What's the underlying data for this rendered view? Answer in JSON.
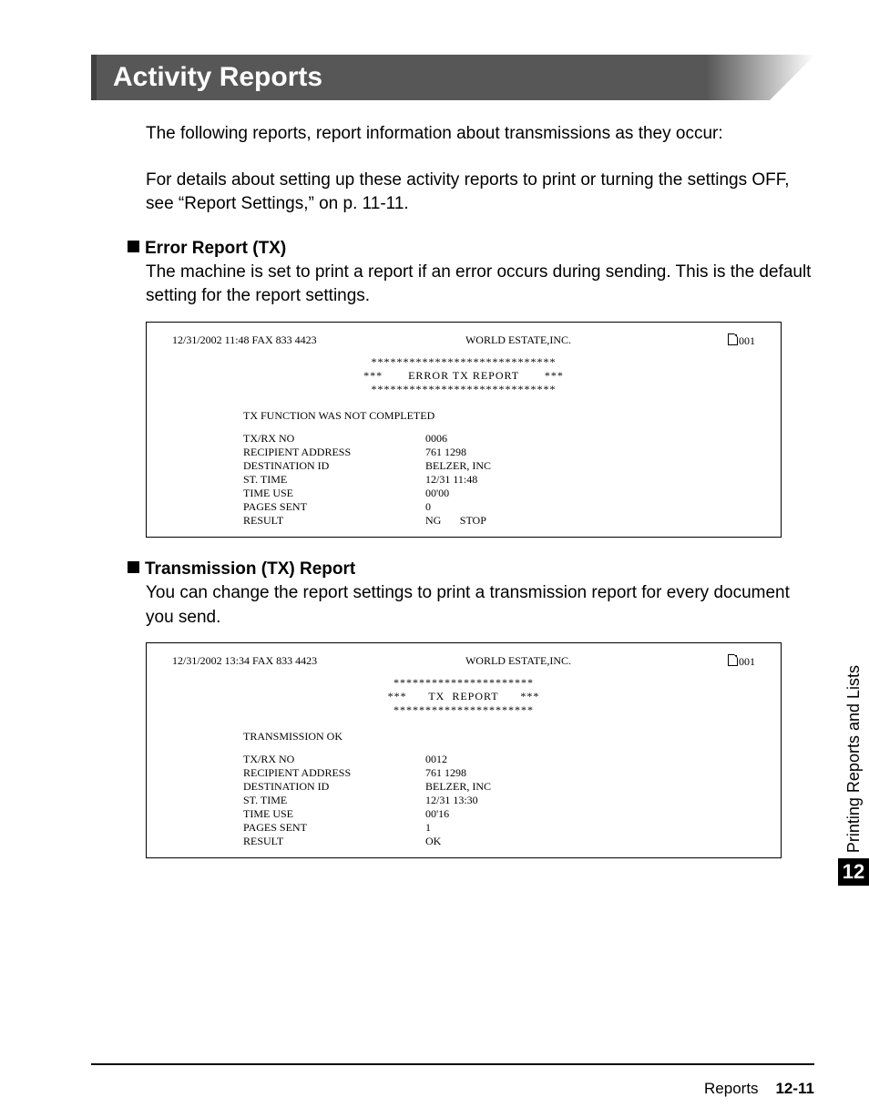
{
  "page_title": "Activity Reports",
  "intro1": "The following reports, report information about transmissions as they occur:",
  "intro2": "For details about setting up these activity reports to print or turning the settings OFF, see “Report Settings,” on p. 11-11.",
  "section_error": {
    "heading": "Error Report (TX)",
    "desc": "The machine is set to print a report if an error occurs during sending. This is the default setting for the report settings."
  },
  "section_tx": {
    "heading": "Transmission (TX) Report",
    "desc": "You can change the report settings to print a transmission report for every document you send."
  },
  "report1": {
    "header_left": "12/31/2002    11:48    FAX  833  4423",
    "header_mid": "WORLD  ESTATE,INC.",
    "header_right": "001",
    "center_star": "*****************************",
    "center_title": "***       ERROR TX REPORT       ***",
    "status": "TX  FUNCTION  WAS  NOT  COMPLETED",
    "rows": [
      {
        "k": "TX/RX  NO",
        "v": "0006",
        "r": ""
      },
      {
        "k": "RECIPIENT ADDRESS",
        "v": "761  1298",
        "r": ""
      },
      {
        "k": "DESTINATION ID",
        "v": "BELZER, INC",
        "r": ""
      },
      {
        "k": "ST.  TIME",
        "v": "12/31   11:48",
        "r": ""
      },
      {
        "k": "TIME USE",
        "v": "00'00",
        "r": ""
      },
      {
        "k": "PAGES  SENT",
        "v": "    0",
        "r": ""
      },
      {
        "k": "RESULT",
        "v": "NG",
        "r": "STOP"
      }
    ]
  },
  "report2": {
    "header_left": "12/31/2002    13:34    FAX  833  4423",
    "header_mid": "WORLD  ESTATE,INC.",
    "header_right": "001",
    "center_star": "**********************",
    "center_title": "***      TX  REPORT      ***",
    "status": "TRANSMISSION  OK",
    "rows": [
      {
        "k": "TX/RX  NO",
        "v": "0012",
        "r": ""
      },
      {
        "k": "RECIPIENT ADDRESS",
        "v": "761  1298",
        "r": ""
      },
      {
        "k": "DESTINATION ID",
        "v": "BELZER, INC",
        "r": ""
      },
      {
        "k": "ST.  TIME",
        "v": "12/31   13:30",
        "r": ""
      },
      {
        "k": "TIME USE",
        "v": "00'16",
        "r": ""
      },
      {
        "k": "PAGES  SENT",
        "v": "    1",
        "r": ""
      },
      {
        "k": "RESULT",
        "v": "OK",
        "r": ""
      }
    ]
  },
  "side_tab": {
    "label": "Printing Reports and Lists",
    "num": "12"
  },
  "footer": {
    "label": "Reports",
    "page": "12-11"
  }
}
